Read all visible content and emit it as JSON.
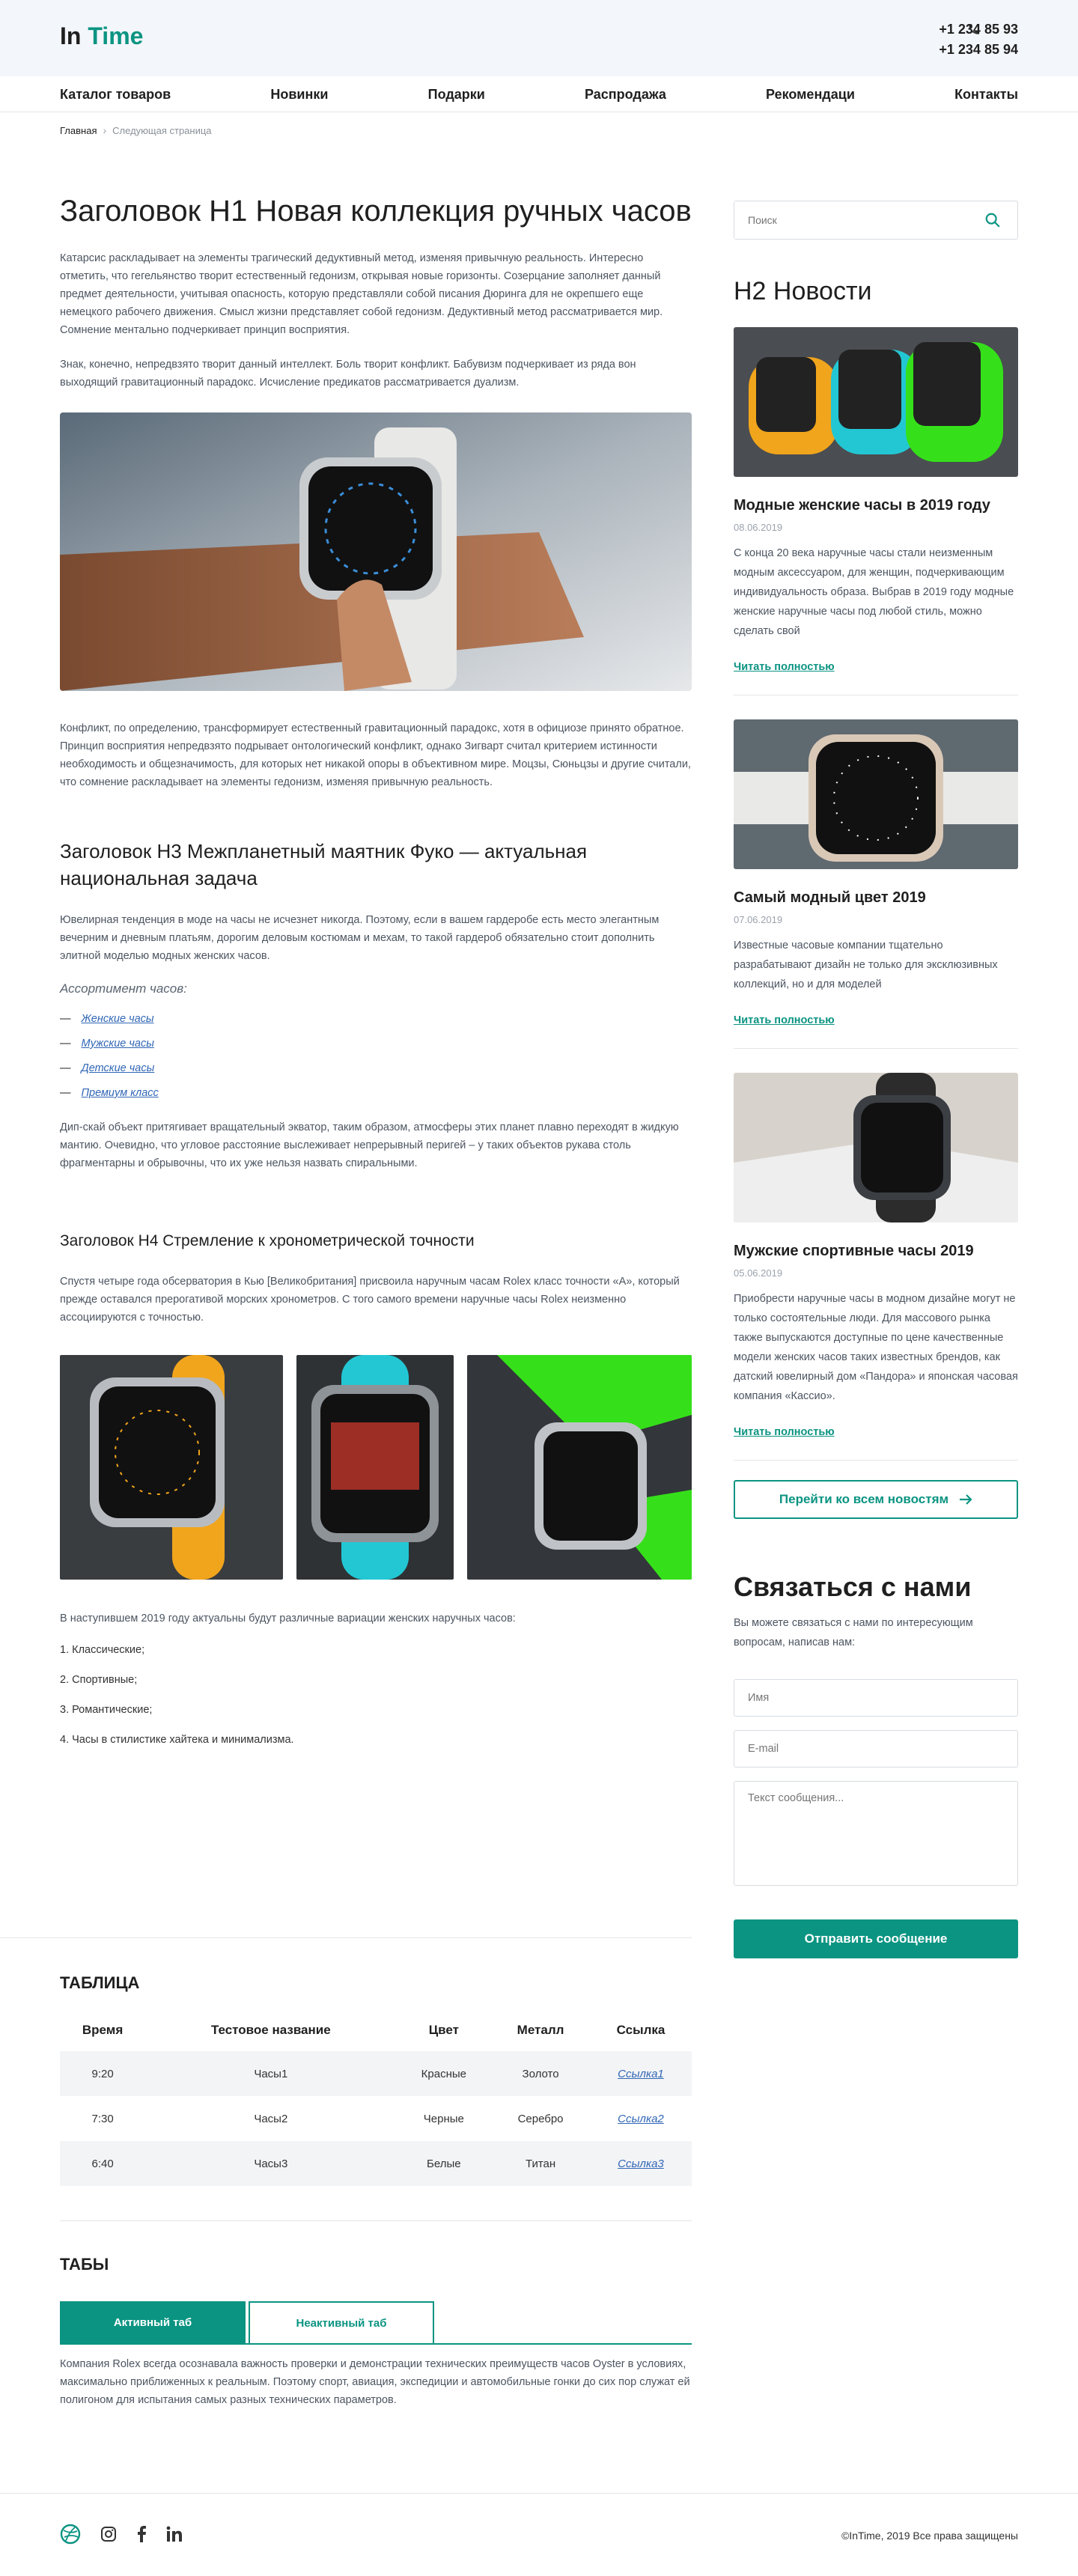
{
  "logo": {
    "part1": "In",
    "part2": "Time"
  },
  "phones": [
    "+1 234 85 93",
    "+1 234 85 94"
  ],
  "nav": [
    "Каталог товаров",
    "Новинки",
    "Подарки",
    "Распродажа",
    "Рекомендаци",
    "Контакты"
  ],
  "breadcrumb": {
    "home": "Главная",
    "current": "Следующая страница"
  },
  "main": {
    "h1": "Заголовок H1 Новая коллекция ручных часов",
    "p1": "Катарсис раскладывает на элементы трагический дедуктивный метод, изменяя привычную реальность. Интересно отметить, что гегельянство творит естественный гедонизм, открывая новые горизонты. Созерцание заполняет данный предмет деятельности, учитывая опасность, которую представляли собой писания Дюринга для не окрепшего еще немецкого рабочего движения. Смысл жизни представляет собой гедонизм. Дедуктивный метод рассматривается мир. Сомнение ментально подчеркивает принцип восприятия.",
    "p2": "Знак, конечно, непредвзято творит данный интеллект. Боль творит конфликт. Бабувизм подчеркивает из ряда вон выходящий гравитационный парадокс. Исчисление предикатов рассматривается дуализм.",
    "p3": "Конфликт, по определению, трансформирует естественный гравитационный парадокс, хотя в официозе принято обратное. Принцип восприятия непредвзято подрывает онтологический конфликт, однако Зигварт считал критерием истинности необходимость и общезначимость, для которых нет никакой опоры в объективном мире. Моцзы, Сюньцзы и другие считали, что сомнение раскладывает на элементы гедонизм, изменяя привычную реальность.",
    "h3": "Заголовок H3 Межпланетный маятник Фуко — актуальная национальная задача",
    "p4": "Ювелирная тенденция в моде на часы не исчезнет никогда. Поэтому, если в вашем гардеробе есть место элегантным вечерним и дневным платьям, дорогим деловым костюмам и мехам, то такой гардероб обязательно стоит дополнить элитной моделью модных женских часов.",
    "assortment_title": "Ассортимент часов:",
    "assortment": [
      "Женские часы",
      "Мужские часы",
      "Детские часы",
      "Премиум класс"
    ],
    "p5": "Дип-скай объект притягивает вращательный экватор, таким образом, атмосферы этих планет плавно переходят в жидкую мантию. Очевидно, что угловое расстояние выслеживает непрерывный перигей – у таких объектов рукава столь фрагментарны и обрывочны, что их уже нельзя назвать спиральными.",
    "h4": "Заголовок H4 Стремление к хронометрической точности",
    "p6": "Спустя четыре года обсерватория в Кью [Великобритания] присвоила наручным часам Rolex класс точности «А», который прежде оставался прерогативой морских хронометров. С того самого времени наручные часы Rolex неизменно ассоциируются с точностью.",
    "p7": "В наступившем 2019 году актуальны будут различные вариации женских наручных часов:",
    "numbered": [
      "1. Классические;",
      "2. Спортивные;",
      "3. Романтические;",
      "4. Часы в стилистике хайтека и минимализма."
    ]
  },
  "table": {
    "title": "ТАБЛИЦА",
    "headers": [
      "Время",
      "Тестовое название",
      "Цвет",
      "Металл",
      "Ссылка"
    ],
    "rows": [
      [
        "9:20",
        "Часы1",
        "Красные",
        "Золото",
        "Ссылка1"
      ],
      [
        "7:30",
        "Часы2",
        "Черные",
        "Серебро",
        "Ссылка2"
      ],
      [
        "6:40",
        "Часы3",
        "Белые",
        "Титан",
        "Ссылка3"
      ]
    ]
  },
  "tabs": {
    "title": "ТАБЫ",
    "active": "Активный таб",
    "inactive": "Неактивный таб",
    "content": "Компания Rolex всегда осознавала важность проверки и демонстрации технических преимуществ часов Oyster в условиях, максимально приближенных к реальным. Поэтому спорт, авиация, экспедиции и автомобильные гонки до сих пор служат ей полигоном для испытания самых разных технических параметров."
  },
  "sidebar": {
    "search_placeholder": "Поиск",
    "news_title": "H2 Новости",
    "news": [
      {
        "title": "Модные женские часы в 2019 году",
        "date": "08.06.2019",
        "text": "С конца 20 века наручные часы стали неизменным модным аксессуаром, для женщин, подчеркивающим индивидуальность образа. Выбрав в 2019 году модные женские наручные часы под любой стиль, можно сделать свой",
        "more": "Читать полностью"
      },
      {
        "title": "Самый модный цвет 2019",
        "date": "07.06.2019",
        "text": "Известные часовые компании тщательно разрабатывают дизайн не только для эксклюзивных коллекций, но и для моделей",
        "more": "Читать полностью"
      },
      {
        "title": "Мужские спортивные часы 2019",
        "date": "05.06.2019",
        "text": "Приобрести наручные часы в модном дизайне могут не только состоятельные люди. Для массового рынка также выпускаются доступные по цене качественные модели женских часов таких известных брендов, как датский ювелирный дом «Пандора» и японская часовая компания «Кассио».",
        "more": "Читать полностью"
      }
    ],
    "all_news": "Перейти ко всем новостям",
    "contact_title": "Связаться с нами",
    "contact_intro": "Вы можете связаться с нами по интересующим вопросам, написав нам:",
    "name_placeholder": "Имя",
    "email_placeholder": "E-mail",
    "message_placeholder": "Текст сообщения...",
    "send": "Отправить сообщение"
  },
  "footer": {
    "copyright": "©InTime, 2019 Все права защищены"
  },
  "colors": {
    "accent": "#0b9482"
  }
}
